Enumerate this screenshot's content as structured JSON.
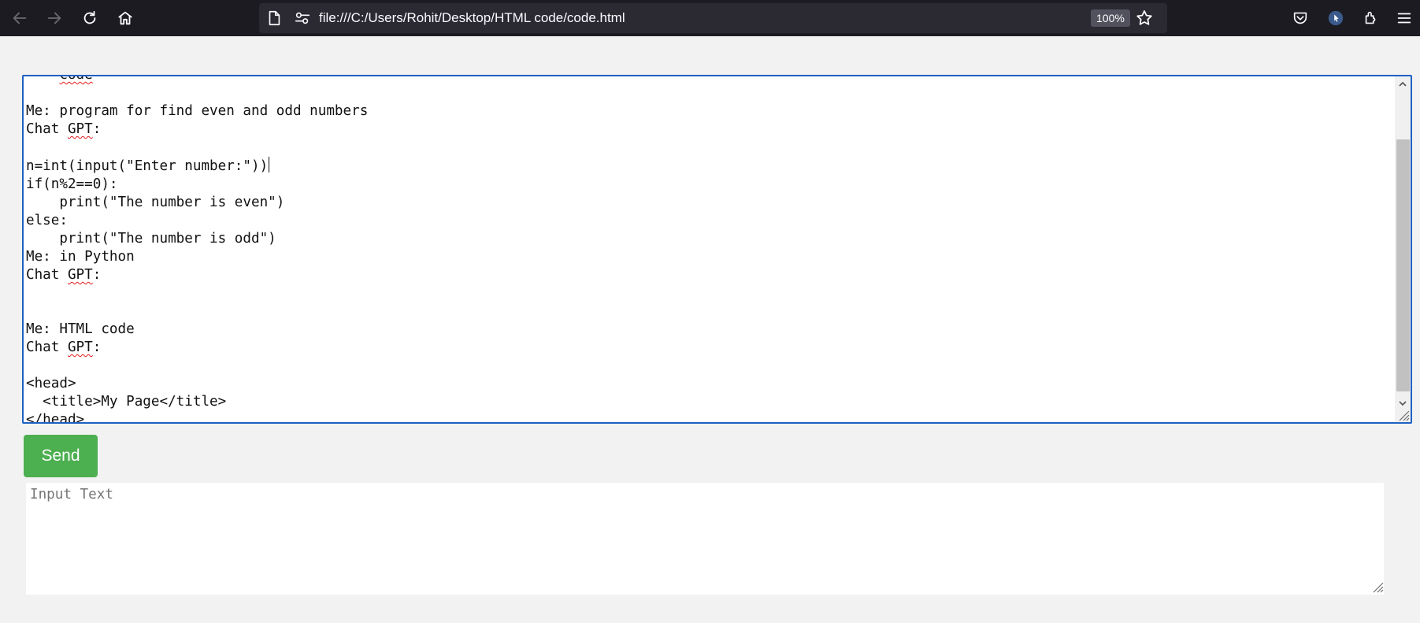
{
  "browser": {
    "url": "file:///C:/Users/Rohit/Desktop/HTML code/code.html",
    "zoom": "100%",
    "icons": [
      "back-icon",
      "forward-icon",
      "reload-icon",
      "home-icon",
      "page-icon",
      "permissions-icon",
      "bookmark-star-icon",
      "pocket-icon",
      "profile-icon",
      "extensions-icon",
      "menu-icon"
    ],
    "colors": {
      "toolbar_bg": "#1c1b22",
      "urlbar_bg": "#2b2a33",
      "focus_border": "#1f61c4"
    }
  },
  "chat": {
    "top_partial": "code",
    "lines": [
      "",
      "Me: program for find even and odd numbers",
      "Chat GPT:",
      "",
      "n=int(input(\"Enter number:\"))",
      "if(n%2==0):",
      "    print(\"The number is even\")",
      "else:",
      "    print(\"The number is odd\")",
      "Me: in Python",
      "Chat GPT:",
      "",
      "",
      "Me: HTML code",
      "Chat GPT:",
      "",
      "<head>",
      "  <title>My Page</title>",
      "</head>"
    ]
  },
  "send_button": {
    "label": "Send",
    "color": "#4caf50"
  },
  "input": {
    "placeholder": "Input Text",
    "value": ""
  }
}
